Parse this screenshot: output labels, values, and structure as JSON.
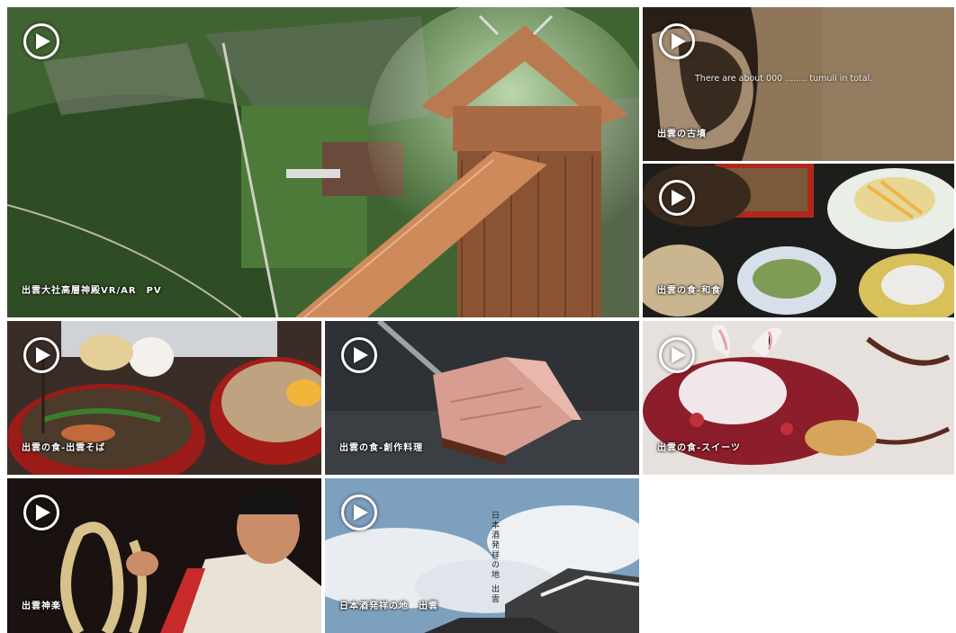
{
  "tiles": [
    {
      "caption": "出雲大社高層神殿VR/AR　PV"
    },
    {
      "caption": "出雲の古墳",
      "overlay": "There are about 000 ........ tumuli in total."
    },
    {
      "caption": "出雲の食-和食"
    },
    {
      "caption": "出雲の食-出雲そば"
    },
    {
      "caption": "出雲の食-創作料理"
    },
    {
      "caption": "出雲の食-スイーツ"
    },
    {
      "caption": "出雲神楽"
    },
    {
      "caption": "日本酒発祥の地　出雲",
      "vertical": "日本酒発祥の地 出雲"
    }
  ]
}
